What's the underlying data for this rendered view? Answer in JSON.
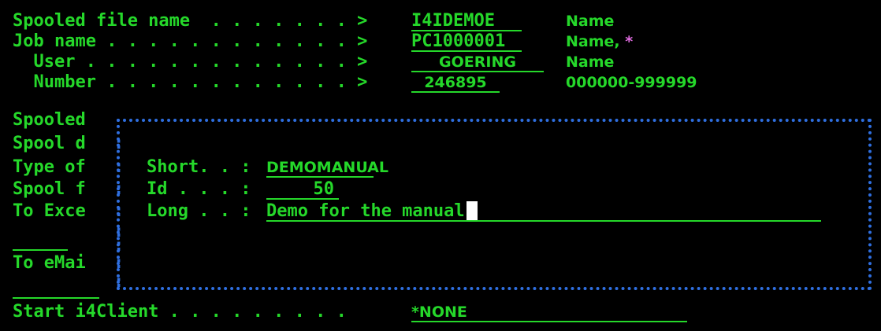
{
  "fields": {
    "spooled_file_name": {
      "label": "Spooled file name  . . . . . . . >",
      "value": "I4IDEMOE",
      "hint": "Name"
    },
    "job_name": {
      "label": "Job name . . . . . . . . . . . . >",
      "value": "PC1000001",
      "hint": "Name, ",
      "hint_extra": "*"
    },
    "user": {
      "label": "  User . . . . . . . . . . . . . >",
      "value": "GOERING",
      "hint": "Name"
    },
    "number": {
      "label": "  Number . . . . . . . . . . . . >",
      "value": "246895",
      "hint": "000000-999999"
    }
  },
  "background_rows": {
    "r1": "Spooled",
    "r2": "Spool d",
    "r3": "Type of",
    "r4": "Spool f",
    "r5": "To Exce",
    "r6": "To eMai"
  },
  "start_client": {
    "label": "Start i4Client . . . . . . . . .",
    "value": "*NONE"
  },
  "popup": {
    "colons": [
      ":",
      ":",
      ":",
      ":",
      ":",
      ":",
      ":",
      ":"
    ],
    "short": {
      "label": "Short. . :",
      "value": "DEMOMANUAL"
    },
    "id": {
      "label": "Id . . . :",
      "value": "50"
    },
    "long": {
      "label": "Long . . :",
      "value": "Demo for the manual"
    }
  }
}
